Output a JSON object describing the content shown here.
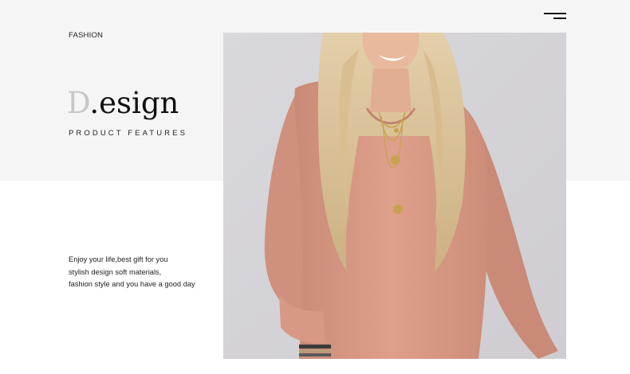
{
  "header": {
    "menu_icon": "hamburger-menu-icon"
  },
  "hero_text": {
    "category": "FASHION",
    "brand_initial": "D",
    "brand_dot": ".",
    "brand_rest": "esign",
    "subtitle": "PRODUCT FEATURES"
  },
  "description": {
    "lines": [
      "Enjoy your life,best gift for you",
      "stylish design soft materials,",
      "fashion style and you have a good day"
    ]
  },
  "hero_image": {
    "alt": "model-photo",
    "colors": {
      "background": "#dcdbdf",
      "sweater": "#d99a86",
      "hair": "#dcc49a",
      "skin": "#e8b99c",
      "jewelry": "#c9a24f"
    }
  }
}
